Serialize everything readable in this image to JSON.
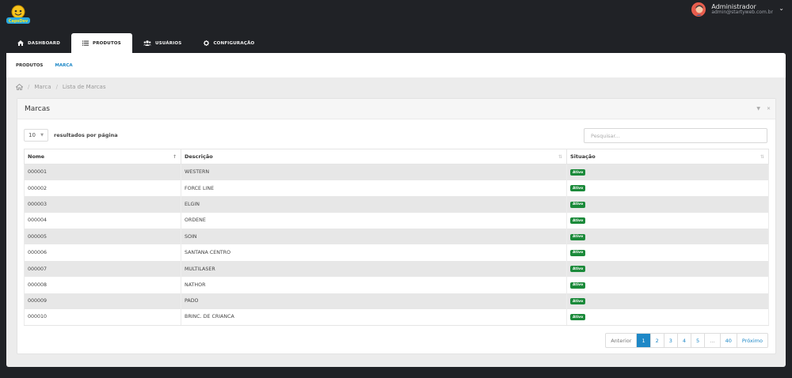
{
  "header": {
    "logo_text": "CapsDev",
    "user": {
      "name": "Administrador",
      "email": "admin@startyweb.com.br"
    }
  },
  "nav": {
    "tabs": [
      {
        "label": "DASHBOARD",
        "icon": "home-icon"
      },
      {
        "label": "PRODUTOS",
        "icon": "list-icon",
        "active": true
      },
      {
        "label": "USUÁRIOS",
        "icon": "users-icon"
      },
      {
        "label": "CONFIGURAÇÃO",
        "icon": "gear-icon"
      }
    ]
  },
  "subnav": {
    "items": [
      {
        "label": "PRODUTOS"
      },
      {
        "label": "MARCA",
        "active": true
      }
    ]
  },
  "breadcrumb": {
    "items": [
      "Marca",
      "Lista de Marcas"
    ]
  },
  "panel": {
    "title": "Marcas"
  },
  "controls": {
    "length_value": "10",
    "length_label": "resultados por página",
    "search_placeholder": "Pesquisar..."
  },
  "table": {
    "columns": [
      "Nome",
      "Descrição",
      "Situação"
    ],
    "rows": [
      [
        "000001",
        "WESTERN",
        "Ativo"
      ],
      [
        "000002",
        "FORCE LINE",
        "Ativo"
      ],
      [
        "000003",
        "ELGIN",
        "Ativo"
      ],
      [
        "000004",
        "ORDENE",
        "Ativo"
      ],
      [
        "000005",
        "SOIN",
        "Ativo"
      ],
      [
        "000006",
        "SANTANA CENTRO",
        "Ativo"
      ],
      [
        "000007",
        "MULTILASER",
        "Ativo"
      ],
      [
        "000008",
        "NATHOR",
        "Ativo"
      ],
      [
        "000009",
        "PADO",
        "Ativo"
      ],
      [
        "000010",
        "BRINC. DE CRIANCA",
        "Ativo"
      ]
    ]
  },
  "pagination": {
    "prev": "Anterior",
    "pages": [
      "1",
      "2",
      "3",
      "4",
      "5",
      "…",
      "40"
    ],
    "next": "Próximo",
    "active": "1"
  },
  "colors": {
    "accent": "#1e88c7",
    "badge": "#1b8a3a",
    "header_bg": "#202226"
  }
}
